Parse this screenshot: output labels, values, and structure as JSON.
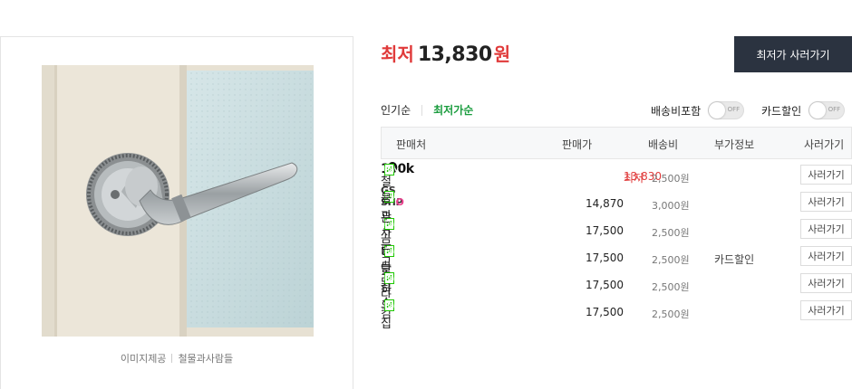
{
  "image_panel": {
    "credit_label": "이미지제공",
    "credit_source": "철물과사람들"
  },
  "summary": {
    "prefix": "최저",
    "price": "13,830",
    "unit": "원",
    "buy_button": "최저가 사러가기"
  },
  "sort": {
    "tabs": [
      {
        "label": "인기순",
        "active": false
      },
      {
        "label": "최저가순",
        "active": true
      }
    ]
  },
  "filters": {
    "shipping": {
      "label": "배송비포함",
      "state": "OFF"
    },
    "card": {
      "label": "카드할인",
      "state": "OFF"
    }
  },
  "table": {
    "headers": {
      "seller": "판매처",
      "price": "판매가",
      "shipping": "배송비",
      "extra": "부가정보",
      "buy": "사러가기"
    },
    "rows": [
      {
        "seller": "1300k",
        "npay": "Pay",
        "lowest_label": "최저",
        "price": "13,830",
        "shipping": "2,500원",
        "extra": "",
        "buy": "사러가기"
      },
      {
        "seller": "GS SHOP",
        "npay": "Pay",
        "price": "14,870",
        "shipping": "3,000원",
        "extra": "",
        "buy": "사러가기"
      },
      {
        "seller": "철물과사람들",
        "npay": "Pay",
        "price": "17,500",
        "shipping": "2,500원",
        "extra": "",
        "buy": "사러가기"
      },
      {
        "seller": "문고리닷컴",
        "npay": "Pay",
        "price": "17,500",
        "shipping": "2,500원",
        "extra": "카드할인",
        "buy": "사러가기"
      },
      {
        "seller": "문고리닷컴",
        "npay": "Pay",
        "price": "17,500",
        "shipping": "2,500원",
        "extra": "",
        "buy": "사러가기"
      },
      {
        "seller": "하우집",
        "npay": "Pay",
        "price": "17,500",
        "shipping": "2,500원",
        "extra": "",
        "buy": "사러가기"
      }
    ]
  },
  "colors": {
    "accent_red": "#e03a3a",
    "active_green": "#1a9c3e",
    "npay_green": "#1ec800",
    "dark_button": "#2b3340"
  }
}
